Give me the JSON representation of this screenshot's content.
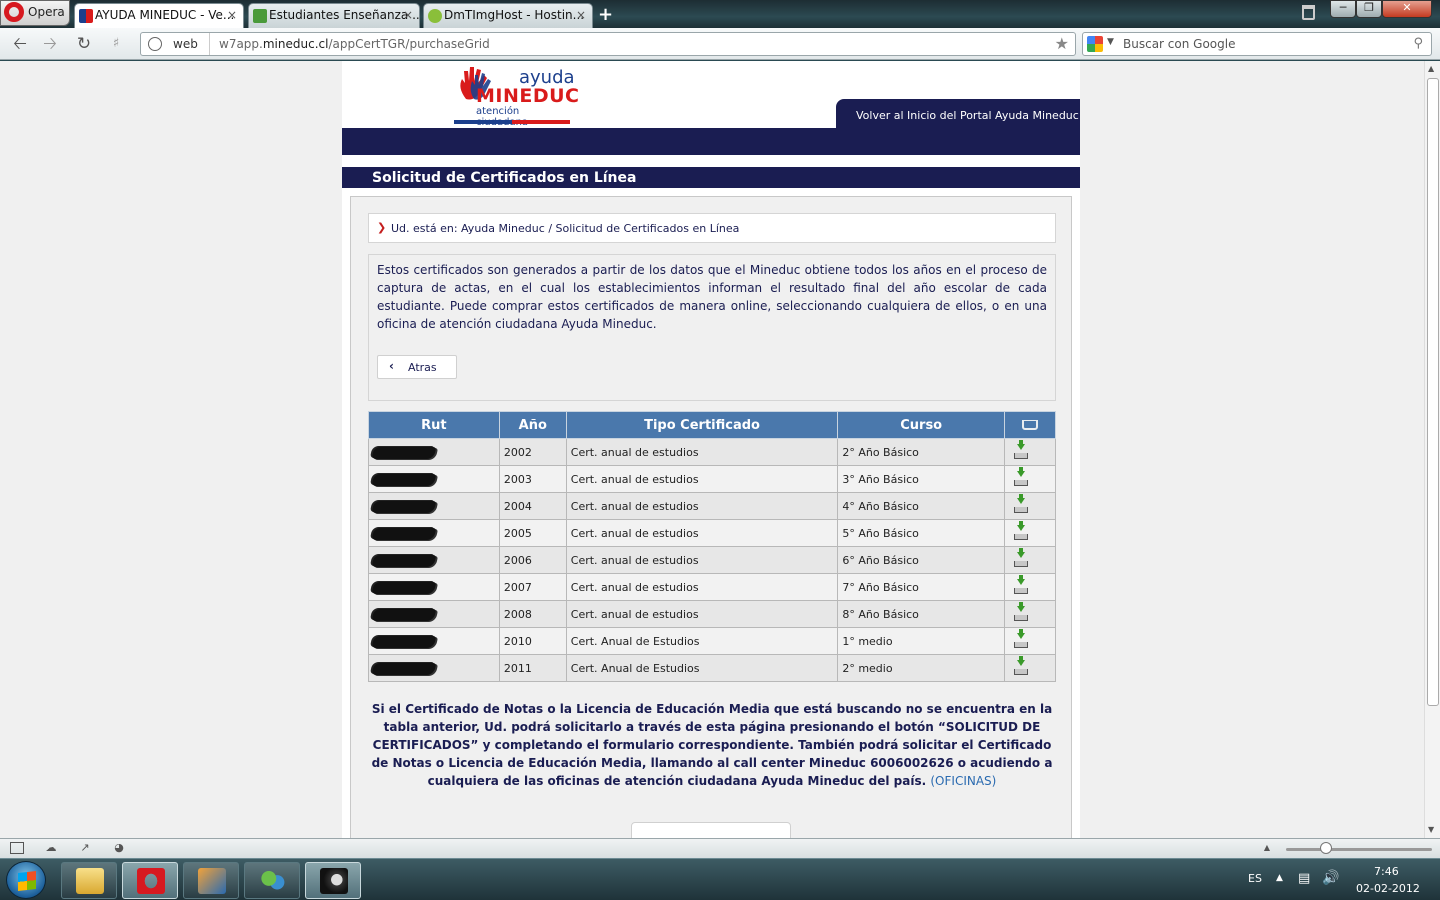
{
  "browser": {
    "menu_label": "Opera",
    "tabs": [
      {
        "title": "AYUDA MINEDUC - Ve...",
        "active": true
      },
      {
        "title": "Estudiantes Enseñanza ...",
        "active": false
      },
      {
        "title": "DmTImgHost - Hostin...",
        "active": false
      }
    ],
    "close_glyph": "×",
    "new_tab_glyph": "+",
    "address": {
      "security_label": "web",
      "url_prefix": "w7app.",
      "url_host": "mineduc.cl",
      "url_path": "/appCertTGR/purchaseGrid"
    },
    "search_placeholder": "Buscar con Google"
  },
  "header": {
    "logo": {
      "line1": "ayuda",
      "line2": "MINEDUC",
      "line3": "atención ciudadana"
    },
    "back_to_portal": "Volver al Inicio del Portal Ayuda Mineduc",
    "section_title": "Solicitud de Certificados en Línea"
  },
  "breadcrumb": {
    "prefix": "Ud. está en:",
    "items": [
      "Ayuda Mineduc",
      "Solicitud de Certificados en Línea"
    ],
    "separator": "/"
  },
  "intro_text": "Estos certificados son generados a partir de los datos que el Mineduc obtiene todos los años en el proceso de captura de actas, en el cual los establecimientos informan el resultado final del año escolar de cada estudiante. Puede comprar estos certificados de manera online, seleccionando cualquiera de ellos, o en una oficina de atención ciudadana Ayuda Mineduc.",
  "back_button": "Atras",
  "table": {
    "headers": [
      "Rut",
      "Año",
      "Tipo Certificado",
      "Curso"
    ],
    "cart_icon": "cart-icon",
    "rows": [
      {
        "year": "2002",
        "type": "Cert. anual de estudios",
        "course": "2° Año Básico"
      },
      {
        "year": "2003",
        "type": "Cert. anual de estudios",
        "course": "3° Año Básico"
      },
      {
        "year": "2004",
        "type": "Cert. anual de estudios",
        "course": "4° Año Básico"
      },
      {
        "year": "2005",
        "type": "Cert. anual de estudios",
        "course": "5° Año Básico"
      },
      {
        "year": "2006",
        "type": "Cert. anual de estudios",
        "course": "6° Año Básico"
      },
      {
        "year": "2007",
        "type": "Cert. anual de estudios",
        "course": "7° Año Básico"
      },
      {
        "year": "2008",
        "type": "Cert. anual de estudios",
        "course": "8° Año Básico"
      },
      {
        "year": "2010",
        "type": "Cert. Anual de Estudios",
        "course": "1° medio"
      },
      {
        "year": "2011",
        "type": "Cert. Anual de Estudios",
        "course": "2° medio"
      }
    ]
  },
  "notice": {
    "text": "Si el Certificado de Notas o la Licencia de Educación Media que está buscando no se encuentra en la tabla anterior, Ud. podrá solicitarlo a través de esta página presionando el botón “SOLICITUD DE CERTIFICADOS” y completando el formulario correspondiente. También podrá solicitar el Certificado de Notas o Licencia de Educación Media, llamando al call center Mineduc 6006002626 o acudiendo a cualquiera de las oficinas de atención ciudadana Ayuda Mineduc del país.",
    "link": "(OFICINAS)"
  },
  "taskbar": {
    "language": "ES",
    "time": "7:46",
    "date": "02-02-2012"
  },
  "colors": {
    "navy": "#1a1d52",
    "table_header": "#4a78ac",
    "logo_red": "#d91b1b",
    "logo_blue": "#1c3f8c"
  }
}
